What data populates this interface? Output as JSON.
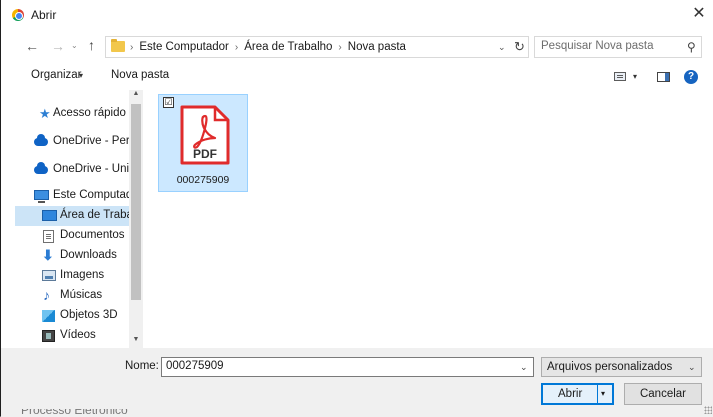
{
  "window": {
    "title": "Abrir",
    "close_glyph": "✕"
  },
  "nav": {
    "back_glyph": "←",
    "forward_glyph": "→",
    "recent_glyph": "⌄",
    "up_glyph": "↑",
    "breadcrumb": [
      "Este Computador",
      "Área de Trabalho",
      "Nova pasta"
    ],
    "breadcrumb_separator": "›",
    "address_dropdown_glyph": "⌄",
    "refresh_glyph": "↻"
  },
  "search": {
    "placeholder": "Pesquisar Nova pasta",
    "icon": "search-icon"
  },
  "toolbar": {
    "organize_label": "Organizar",
    "organize_arrow": "▾",
    "new_folder_label": "Nova pasta",
    "view_arrow": "▾",
    "help_label": "?"
  },
  "sidebar": {
    "scroll_up_glyph": "▲",
    "scroll_down_glyph": "▼",
    "items": [
      {
        "label": "Acesso rápido",
        "icon": "star-icon"
      },
      {
        "label": "OneDrive - Perso",
        "icon": "cloud-icon"
      },
      {
        "label": "OneDrive - Unive",
        "icon": "cloud-icon"
      },
      {
        "label": "Este Computado",
        "icon": "computer-icon"
      },
      {
        "label": "Área de Trabalh",
        "icon": "desktop-icon",
        "selected": true
      },
      {
        "label": "Documentos",
        "icon": "document-icon"
      },
      {
        "label": "Downloads",
        "icon": "download-icon"
      },
      {
        "label": "Imagens",
        "icon": "pictures-icon"
      },
      {
        "label": "Músicas",
        "icon": "music-icon"
      },
      {
        "label": "Objetos 3D",
        "icon": "cube-icon"
      },
      {
        "label": "Vídeos",
        "icon": "video-icon"
      }
    ]
  },
  "files": [
    {
      "name": "000275909",
      "type_label": "PDF",
      "checkbox_glyph": "☑",
      "selected": true,
      "icon": "pdf-icon"
    }
  ],
  "footer": {
    "name_label": "Nome:",
    "name_value": "000275909",
    "name_dropdown_glyph": "⌄",
    "file_type_value": "Arquivos personalizados",
    "file_type_dropdown_glyph": "⌄",
    "open_label": "Abrir",
    "open_split_glyph": "▾",
    "cancel_label": "Cancelar"
  },
  "background_window": {
    "text": "Processo Eletrônico"
  },
  "colors": {
    "selection": "#cce4f7",
    "tile_selection": "#cce8ff",
    "accent": "#0078d7",
    "pdf_red": "#e02b2b"
  }
}
